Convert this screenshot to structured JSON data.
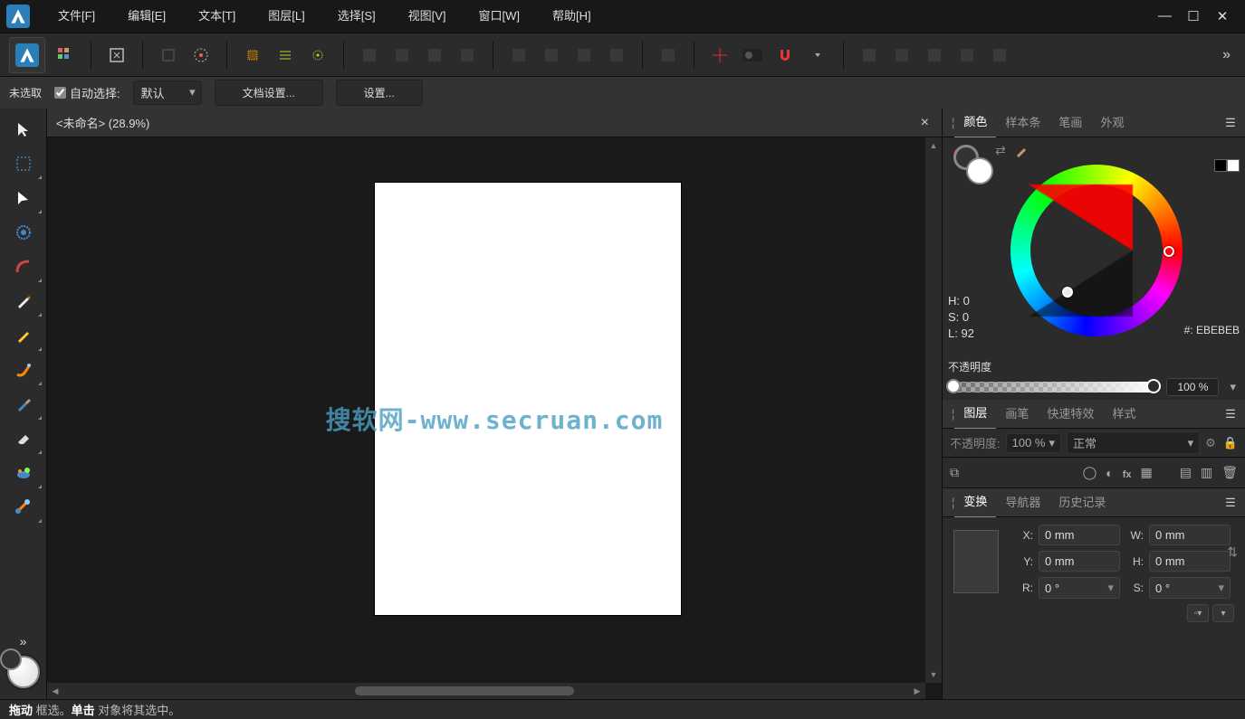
{
  "menu": {
    "file": "文件[F]",
    "edit": "编辑[E]",
    "text": "文本[T]",
    "layer": "图层[L]",
    "select": "选择[S]",
    "view": "视图[V]",
    "window": "窗口[W]",
    "help": "帮助[H]"
  },
  "contextbar": {
    "noselect": "未选取",
    "autoselect": "自动选择:",
    "default": "默认",
    "docsettings": "文档设置...",
    "settings": "设置..."
  },
  "doc": {
    "tabname": "<未命名> (28.9%)"
  },
  "watermark": "搜软网-www.secruan.com",
  "panels": {
    "color": {
      "tab_color": "颜色",
      "tab_swatch": "样本条",
      "tab_stroke": "笔画",
      "tab_appearance": "外观",
      "h": "H: 0",
      "s": "S: 0",
      "l": "L: 92",
      "hex": "#: EBEBEB",
      "opacity_label": "不透明度",
      "opacity": "100 %"
    },
    "layers": {
      "tab_layers": "图层",
      "tab_brush": "画笔",
      "tab_fx": "快速特效",
      "tab_style": "样式",
      "opacity_label": "不透明度:",
      "opacity": "100 %",
      "blend": "正常"
    },
    "transform": {
      "tab_transform": "变换",
      "tab_navigator": "导航器",
      "tab_history": "历史记录",
      "x_lbl": "X:",
      "x": "0 mm",
      "y_lbl": "Y:",
      "y": "0 mm",
      "w_lbl": "W:",
      "w": "0 mm",
      "h_lbl": "H:",
      "h": "0 mm",
      "r_lbl": "R:",
      "r": "0 °",
      "s_lbl": "S:",
      "s": "0 °"
    }
  },
  "status": {
    "drag": "拖动",
    "drag_rest": " 框选。",
    "click": "单击",
    "click_rest": " 对象将其选中。"
  }
}
